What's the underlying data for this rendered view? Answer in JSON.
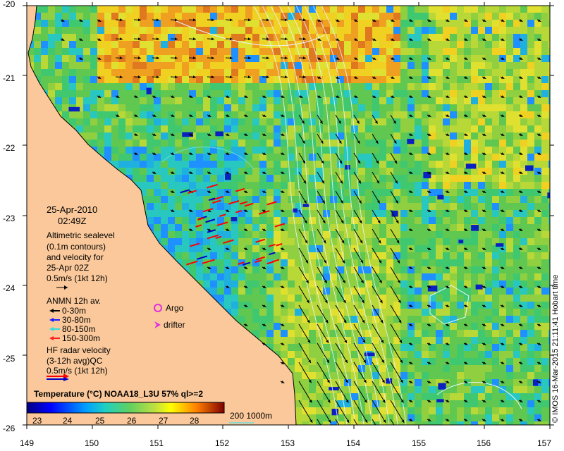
{
  "figure": {
    "date": "25-Apr-2010",
    "time": "02:49Z",
    "credit": "© IMOS 16-Mar-2015 21:11:41 Hobart time"
  },
  "axes": {
    "y_ticks": [
      "-20",
      "-21",
      "-22",
      "-23",
      "-24",
      "-25",
      "-26"
    ],
    "x_ticks": [
      "149",
      "150",
      "151",
      "152",
      "153",
      "154",
      "155",
      "156",
      "157"
    ],
    "lon_range": [
      149,
      157
    ],
    "lat_range": [
      -26,
      -20
    ]
  },
  "legend": {
    "altimetry_lines": [
      "Altimetric sealevel",
      "(0.1m contours)",
      "and velocity for",
      "25-Apr 02Z",
      "0.5m/s (1kt 12h)"
    ],
    "anmn_title": "ANMN 12h av.",
    "anmn_items": [
      {
        "label": "0-30m",
        "color": "#000000"
      },
      {
        "label": "30-80m",
        "color": "#1a1aff"
      },
      {
        "label": "80-150m",
        "color": "#33dddd"
      },
      {
        "label": "150-300m",
        "color": "#ff2020"
      }
    ],
    "argo_label": "Argo",
    "argo_color": "#e030e0",
    "drifter_label": "drifter",
    "drifter_color": "#e030e0",
    "hf_lines": [
      "HF radar velocity",
      "(3-12h avg)QC",
      "0.5m/s (1kt 12h)"
    ]
  },
  "colorbar": {
    "title": "Temperature (°C) NOAA18_L3U 57% ql>=2",
    "ticks": [
      "23",
      "24",
      "25",
      "26",
      "27",
      "28"
    ],
    "range": [
      22.5,
      29
    ]
  },
  "bathymetry": {
    "label": "200  1000m",
    "color": "#66dddd"
  },
  "colors": {
    "land": "#fac89a",
    "arrow_altimetry": "#000000",
    "contour": "#e8f4ff",
    "hf_radar": "#ff0000",
    "hf_radar_alt": "#0000cc"
  }
}
